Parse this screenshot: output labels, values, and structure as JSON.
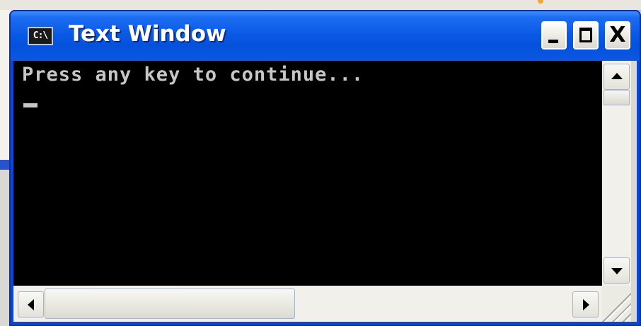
{
  "window": {
    "title": "Text Window",
    "icon_label": "C:\\",
    "icon": "console-icon"
  },
  "titlebar_buttons": {
    "minimize": "minimize-icon",
    "maximize": "maximize-icon",
    "close_label": "X"
  },
  "console": {
    "lines": [
      "Press any key to continue..."
    ],
    "background": "#000000",
    "foreground": "#c6c6c6"
  },
  "scrollbars": {
    "vertical": {
      "up": "scroll-up-arrow-icon",
      "down": "scroll-down-arrow-icon"
    },
    "horizontal": {
      "left": "scroll-left-arrow-icon",
      "right": "scroll-right-arrow-icon"
    }
  },
  "colors": {
    "titlebar": "#0a5ae6",
    "window_border": "#0831a8"
  }
}
